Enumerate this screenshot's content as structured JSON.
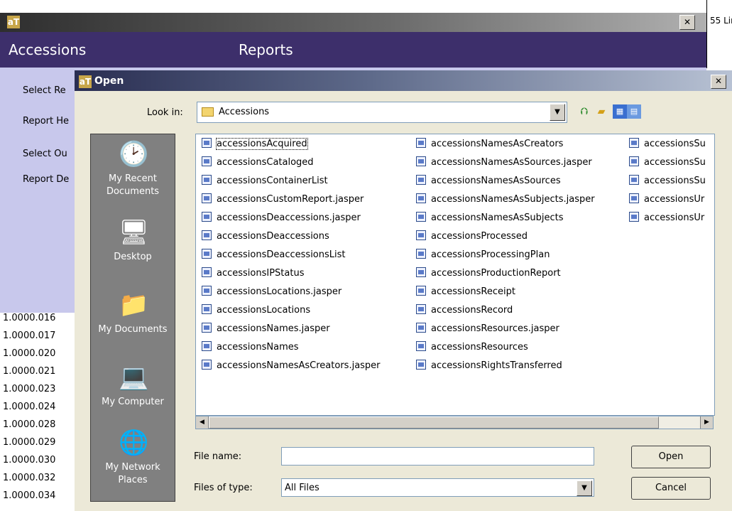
{
  "background_window": {
    "logo_text": "aT",
    "close_label": "✕",
    "right_edge_text": "55 Lir",
    "header_left": "Accessions",
    "header_right": "Reports",
    "form_labels": [
      "Select Re",
      "Report He",
      "Select Ou",
      "Report De"
    ],
    "list_values": [
      "1.0000.016",
      "1.0000.017",
      "1.0000.020",
      "1.0000.021",
      "1.0000.023",
      "1.0000.024",
      "1.0000.028",
      "1.0000.029",
      "1.0000.030",
      "1.0000.032",
      "1.0000.034"
    ]
  },
  "dialog": {
    "logo_text": "aT",
    "title": "Open",
    "close_label": "✕",
    "look_in_label": "Look in:",
    "look_in_value": "Accessions",
    "toolbar_icons": [
      "up-folder-icon",
      "new-folder-icon",
      "view-menu-icon"
    ],
    "places": [
      {
        "label": "My Recent Documents",
        "icon": "recent-documents-icon"
      },
      {
        "label": "Desktop",
        "icon": "desktop-icon"
      },
      {
        "label": "My Documents",
        "icon": "my-documents-icon"
      },
      {
        "label": "My Computer",
        "icon": "my-computer-icon"
      },
      {
        "label": "My Network Places",
        "icon": "network-places-icon"
      }
    ],
    "files": [
      "accessionsAcquired",
      "accessionsCataloged",
      "accessionsContainerList",
      "accessionsCustomReport.jasper",
      "accessionsDeaccessions.jasper",
      "accessionsDeaccessions",
      "accessionsDeaccessionsList",
      "accessionsIPStatus",
      "accessionsLocations.jasper",
      "accessionsLocations",
      "accessionsNames.jasper",
      "accessionsNames",
      "accessionsNamesAsCreators.jasper",
      "accessionsNamesAsCreators",
      "accessionsNamesAsSources.jasper",
      "accessionsNamesAsSources",
      "accessionsNamesAsSubjects.jasper",
      "accessionsNamesAsSubjects",
      "accessionsProcessed",
      "accessionsProcessingPlan",
      "accessionsProductionReport",
      "accessionsReceipt",
      "accessionsRecord",
      "accessionsResources.jasper",
      "accessionsResources",
      "accessionsRightsTransferred",
      "accessionsSu",
      "accessionsSu",
      "accessionsSu",
      "accessionsUr",
      "accessionsUr"
    ],
    "selected_file": "accessionsAcquired",
    "file_name_label": "File name:",
    "file_name_value": "",
    "files_of_type_label": "Files of type:",
    "files_of_type_value": "All Files",
    "open_button": "Open",
    "cancel_button": "Cancel"
  }
}
